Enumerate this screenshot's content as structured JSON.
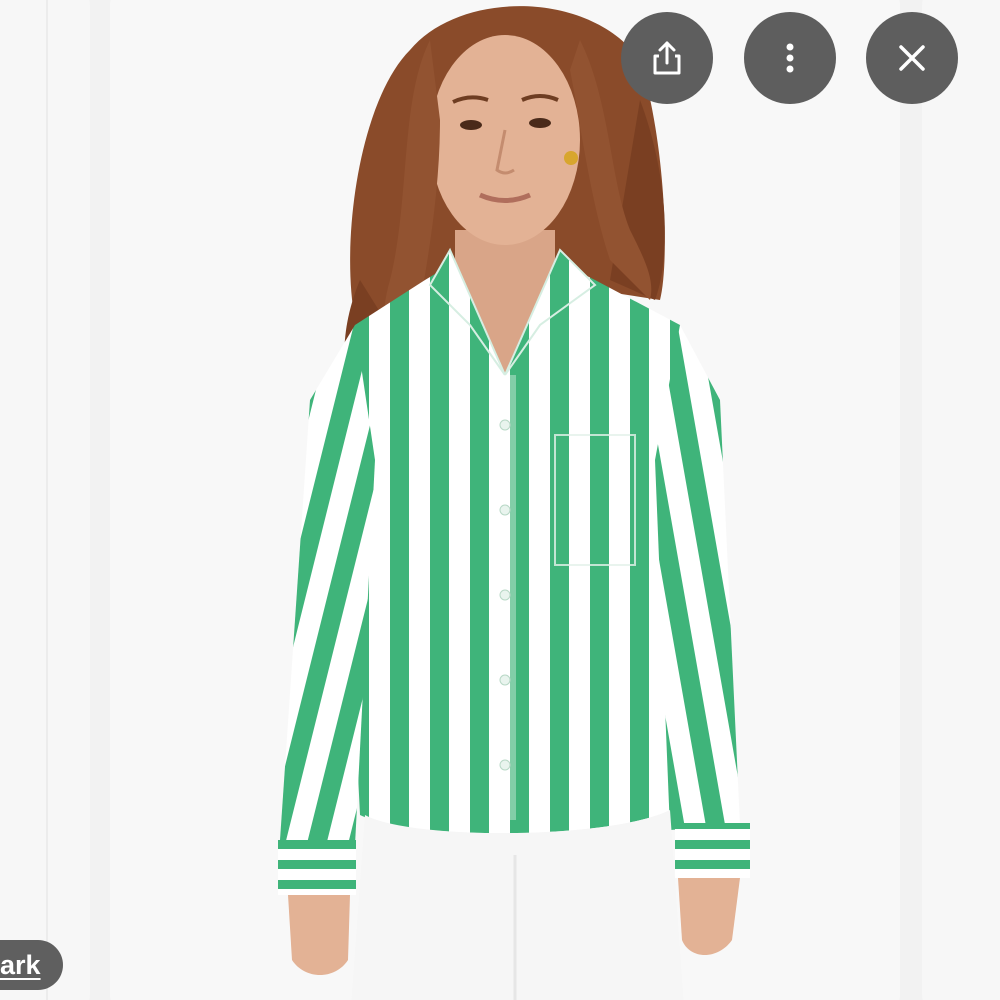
{
  "viewer": {
    "bookmark_chip_label": "ark",
    "actions": [
      {
        "name": "share",
        "icon": "share-icon"
      },
      {
        "name": "more",
        "icon": "more-vertical-icon"
      },
      {
        "name": "close",
        "icon": "close-icon"
      }
    ]
  },
  "image": {
    "subject": "model-wearing-green-striped-shirt",
    "colors": {
      "stripe_green": "#3fb47a",
      "stripe_white": "#ffffff",
      "pants": "#f6f6f6",
      "hair": "#8a4b2a",
      "skin": "#e3b295",
      "background": "#f8f8f8"
    }
  },
  "colors": {
    "button_bg": "#5e5e5e",
    "icon_fg": "#ffffff",
    "page_bg": "#f2f2f2"
  }
}
